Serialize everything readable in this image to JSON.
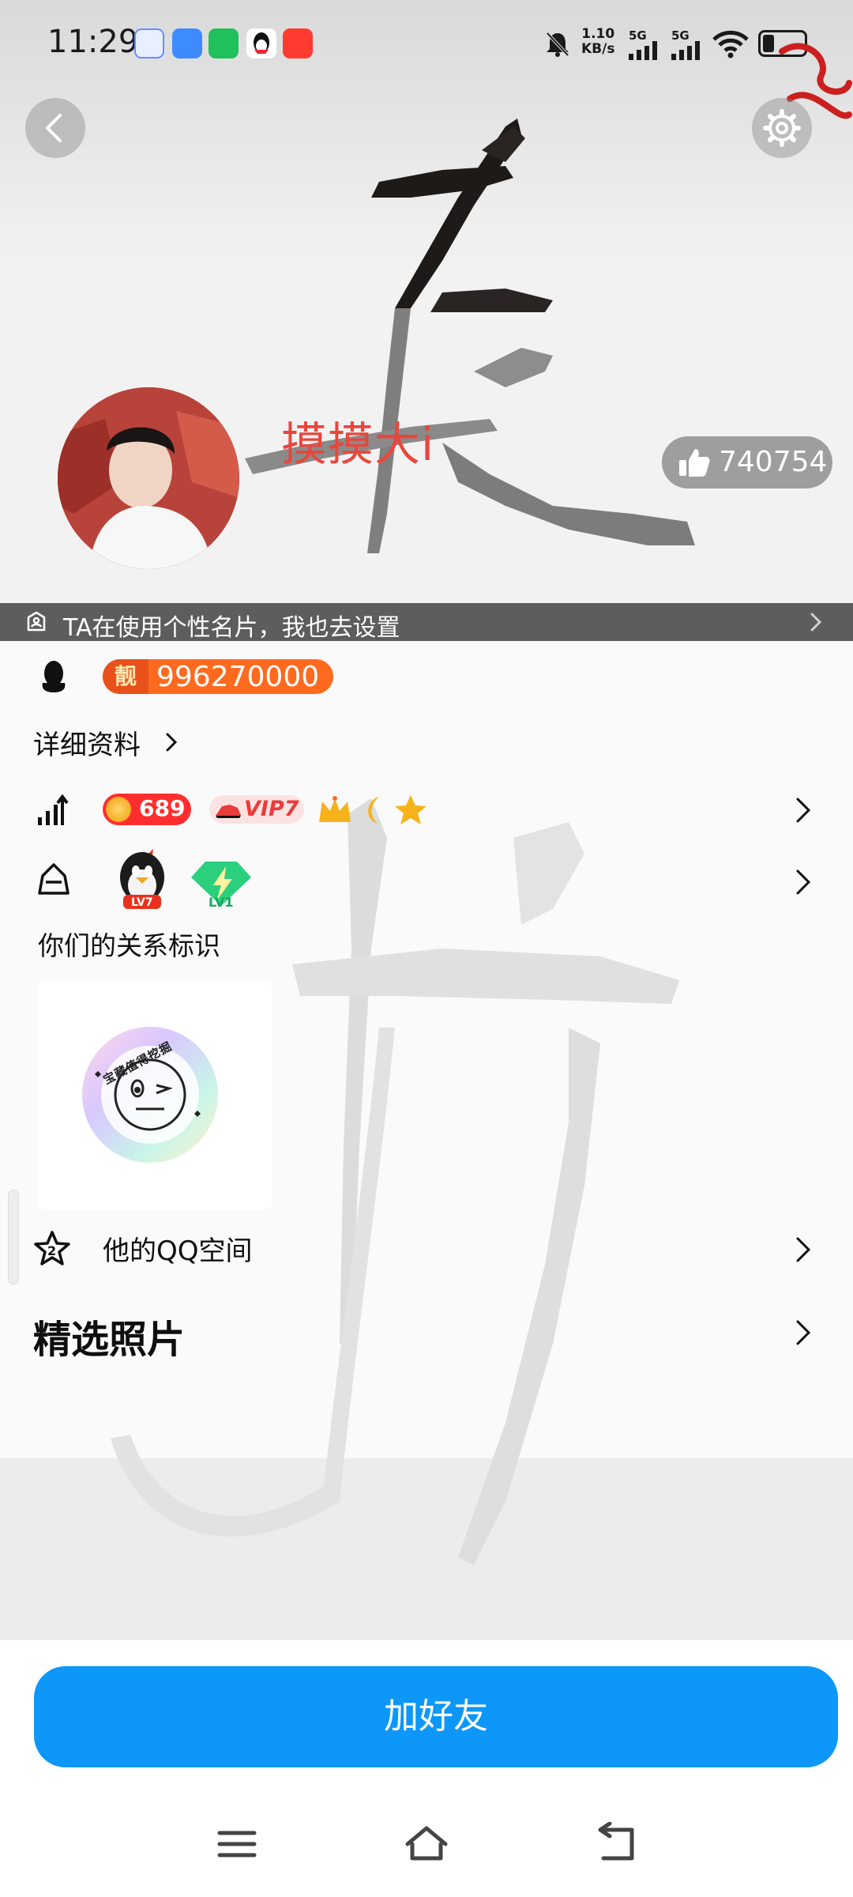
{
  "status_bar": {
    "time": "11:29",
    "net_speed_value": "1.10",
    "net_speed_unit": "KB/s",
    "signal1_label": "5G",
    "signal2_label": "5G"
  },
  "profile": {
    "nickname": "摸摸大i",
    "likes": "740754"
  },
  "card_bar": {
    "text": "TA在使用个性名片，我也去设置"
  },
  "qq": {
    "liang_label": "靓",
    "number": "996270000"
  },
  "details_link": "详细资料",
  "badges": {
    "level": "689",
    "vip": "VIP7",
    "lv_label": "LV7",
    "speed_label": "LV1"
  },
  "relation": {
    "label": "你们的关系标识",
    "badge_text": "宝藏值得挖掘"
  },
  "qzone": {
    "label": "他的QQ空间",
    "badge": "2"
  },
  "photos": {
    "label": "精选照片"
  },
  "add_friend": {
    "label": "加好友"
  },
  "colors": {
    "accent": "#0d97f8",
    "nickname": "#e8473c",
    "qq_number_bg": "#ff6a1f",
    "vip": "#e93c3c"
  }
}
